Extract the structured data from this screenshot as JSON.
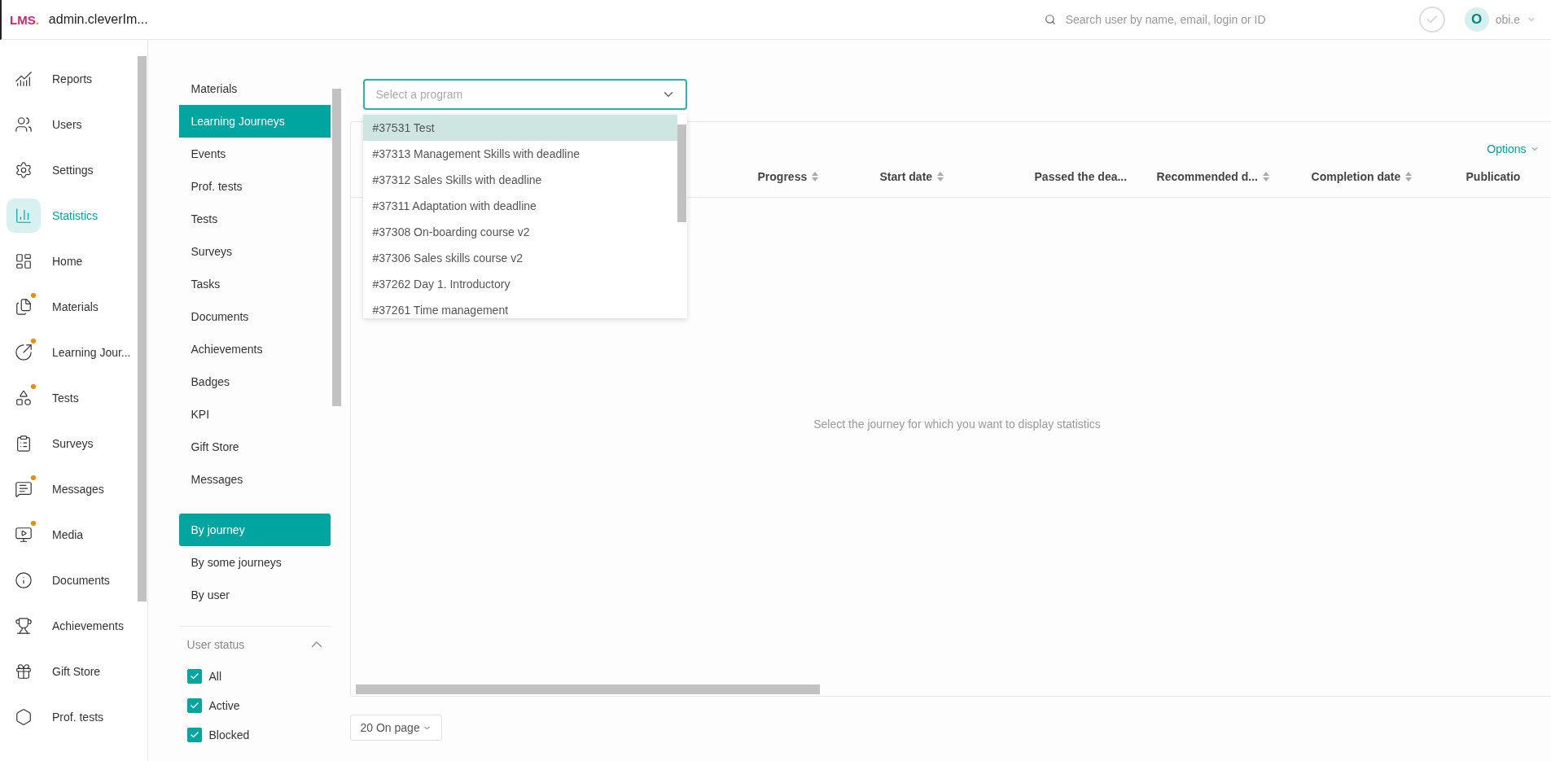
{
  "header": {
    "logo": "LMS",
    "logo_dot": ".",
    "site": "admin.cleverIm...",
    "search": {
      "placeholder": "Search user by name, email, login or ID"
    },
    "user": {
      "initial": "O",
      "name": "obi.e"
    }
  },
  "nav": [
    {
      "label": "Reports",
      "selected": false,
      "badge": false
    },
    {
      "label": "Users",
      "selected": false,
      "badge": false
    },
    {
      "label": "Settings",
      "selected": false,
      "badge": false
    },
    {
      "label": "Statistics",
      "selected": true,
      "badge": false
    },
    {
      "label": "Home",
      "selected": false,
      "badge": false
    },
    {
      "label": "Materials",
      "selected": false,
      "badge": true
    },
    {
      "label": "Learning Jour...",
      "selected": false,
      "badge": true
    },
    {
      "label": "Tests",
      "selected": false,
      "badge": true
    },
    {
      "label": "Surveys",
      "selected": false,
      "badge": false
    },
    {
      "label": "Messages",
      "selected": false,
      "badge": true
    },
    {
      "label": "Media",
      "selected": false,
      "badge": true
    },
    {
      "label": "Documents",
      "selected": false,
      "badge": false
    },
    {
      "label": "Achievements",
      "selected": false,
      "badge": false
    },
    {
      "label": "Gift Store",
      "selected": false,
      "badge": false
    },
    {
      "label": "Prof. tests",
      "selected": false,
      "badge": false
    }
  ],
  "sections": [
    {
      "label": "Materials",
      "selected": false
    },
    {
      "label": "Learning Journeys",
      "selected": true
    },
    {
      "label": "Events",
      "selected": false
    },
    {
      "label": "Prof. tests",
      "selected": false
    },
    {
      "label": "Tests",
      "selected": false
    },
    {
      "label": "Surveys",
      "selected": false
    },
    {
      "label": "Tasks",
      "selected": false
    },
    {
      "label": "Documents",
      "selected": false
    },
    {
      "label": "Achievements",
      "selected": false
    },
    {
      "label": "Badges",
      "selected": false
    },
    {
      "label": "KPI",
      "selected": false
    },
    {
      "label": "Gift Store",
      "selected": false
    },
    {
      "label": "Messages",
      "selected": false
    }
  ],
  "views": [
    {
      "label": "By journey",
      "selected": true
    },
    {
      "label": "By some journeys",
      "selected": false
    },
    {
      "label": "By user",
      "selected": false
    }
  ],
  "user_status": {
    "title": "User status",
    "expanded": true,
    "options": [
      {
        "label": "All",
        "checked": true
      },
      {
        "label": "Active",
        "checked": true
      },
      {
        "label": "Blocked",
        "checked": true
      }
    ]
  },
  "program_select": {
    "placeholder": "Select a program",
    "open": true,
    "options": [
      {
        "label": "#37531 Test",
        "selected": true
      },
      {
        "label": "#37313 Management Skills with deadline",
        "selected": false
      },
      {
        "label": "#37312 Sales Skills with deadline",
        "selected": false
      },
      {
        "label": "#37311 Adaptation with deadline",
        "selected": false
      },
      {
        "label": "#37308 On-boarding course v2",
        "selected": false
      },
      {
        "label": "#37306 Sales skills course v2",
        "selected": false
      },
      {
        "label": "#37262 Day 1. Introductory",
        "selected": false
      },
      {
        "label": "#37261 Time management",
        "selected": false
      }
    ]
  },
  "table": {
    "options": "Options",
    "columns": [
      {
        "label": "Progress",
        "sortable": true
      },
      {
        "label": "Start date",
        "sortable": true
      },
      {
        "label": "Passed the dea...",
        "sortable": false
      },
      {
        "label": "Recommended d...",
        "sortable": true
      },
      {
        "label": "Completion date",
        "sortable": true
      },
      {
        "label": "Publicatio",
        "sortable": false
      }
    ],
    "empty": "Select the journey for which you want to display statistics"
  },
  "page_size": "20 On page"
}
